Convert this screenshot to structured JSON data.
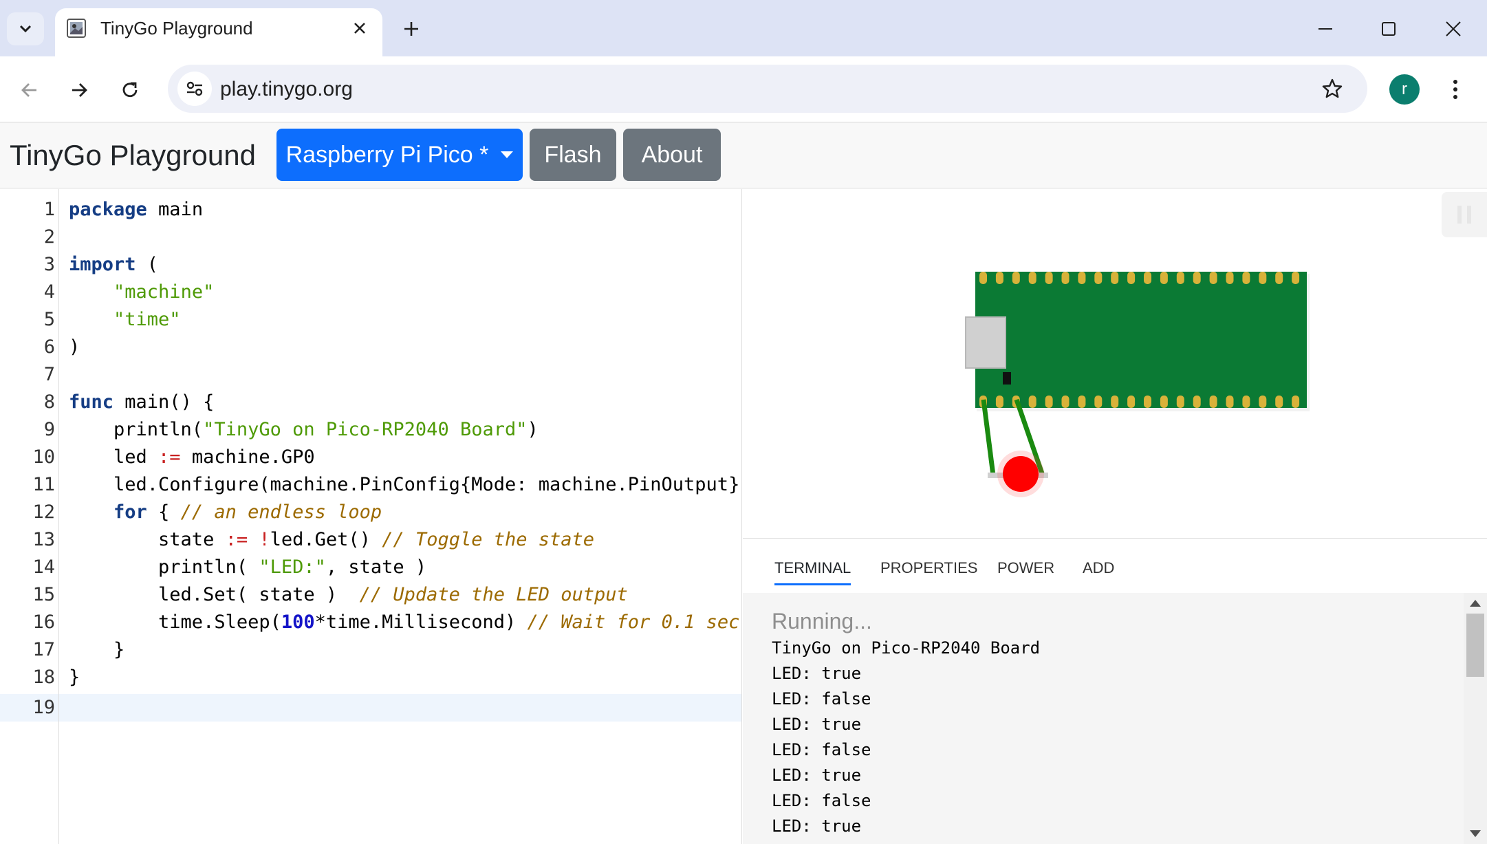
{
  "browser": {
    "tab_title": "TinyGo Playground",
    "url": "play.tinygo.org",
    "profile_initial": "r"
  },
  "header": {
    "title": "TinyGo Playground",
    "board_select": "Raspberry Pi Pico *",
    "flash_label": "Flash",
    "about_label": "About"
  },
  "editor": {
    "line_numbers": [
      "1",
      "2",
      "3",
      "4",
      "5",
      "6",
      "7",
      "8",
      "9",
      "10",
      "11",
      "12",
      "13",
      "14",
      "15",
      "16",
      "17",
      "18",
      "19"
    ],
    "current_line": "19"
  },
  "panel": {
    "tabs": [
      "TERMINAL",
      "PROPERTIES",
      "POWER",
      "ADD"
    ],
    "active_tab": "TERMINAL"
  },
  "terminal": {
    "status": "Running...",
    "lines": [
      "TinyGo on Pico-RP2040 Board",
      "LED: true",
      "LED: false",
      "LED: true",
      "LED: false",
      "LED: true",
      "LED: false",
      "LED: true"
    ]
  },
  "colors": {
    "board_green": "#0b7a34",
    "pad_gold": "#d8b23a",
    "led_red": "#ff0000",
    "wire_green": "#1a8a10",
    "primary_blue": "#0d6efd",
    "secondary_gray": "#6c757d"
  },
  "icons": {
    "tab_search": "chevron-down-icon",
    "tab_close": "close-icon",
    "new_tab": "plus-icon",
    "back": "arrow-left-icon",
    "forward": "arrow-right-icon",
    "reload": "reload-icon",
    "site_info": "tune-icon",
    "bookmark": "star-icon",
    "menu": "kebab-menu-icon",
    "pause": "pause-icon"
  }
}
